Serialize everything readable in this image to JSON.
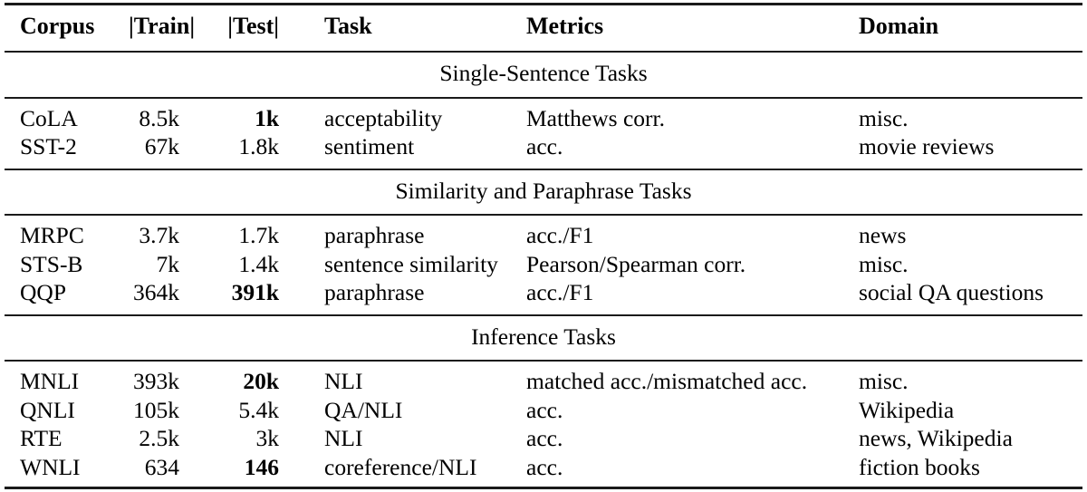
{
  "table": {
    "columns": [
      {
        "key": "corpus",
        "label": "Corpus",
        "align": "left"
      },
      {
        "key": "train",
        "label": "|Train|",
        "align": "right"
      },
      {
        "key": "test",
        "label": "|Test|",
        "align": "right"
      },
      {
        "key": "task",
        "label": "Task",
        "align": "left"
      },
      {
        "key": "metrics",
        "label": "Metrics",
        "align": "left"
      },
      {
        "key": "domain",
        "label": "Domain",
        "align": "left"
      }
    ],
    "sections": [
      {
        "title": "Single-Sentence Tasks",
        "rows": [
          {
            "corpus": "CoLA",
            "train": "8.5k",
            "test": "1k",
            "test_bold": true,
            "task": "acceptability",
            "metrics": "Matthews corr.",
            "domain": "misc."
          },
          {
            "corpus": "SST-2",
            "train": "67k",
            "test": "1.8k",
            "test_bold": false,
            "task": "sentiment",
            "metrics": "acc.",
            "domain": "movie reviews"
          }
        ]
      },
      {
        "title": "Similarity and Paraphrase Tasks",
        "rows": [
          {
            "corpus": "MRPC",
            "train": "3.7k",
            "test": "1.7k",
            "test_bold": false,
            "task": "paraphrase",
            "metrics": "acc./F1",
            "domain": "news"
          },
          {
            "corpus": "STS-B",
            "train": "7k",
            "test": "1.4k",
            "test_bold": false,
            "task": "sentence similarity",
            "metrics": "Pearson/Spearman corr.",
            "domain": "misc."
          },
          {
            "corpus": "QQP",
            "train": "364k",
            "test": "391k",
            "test_bold": true,
            "task": "paraphrase",
            "metrics": "acc./F1",
            "domain": "social QA questions"
          }
        ]
      },
      {
        "title": "Inference Tasks",
        "rows": [
          {
            "corpus": "MNLI",
            "train": "393k",
            "test": "20k",
            "test_bold": true,
            "task": "NLI",
            "metrics": "matched acc./mismatched acc.",
            "domain": "misc."
          },
          {
            "corpus": "QNLI",
            "train": "105k",
            "test": "5.4k",
            "test_bold": false,
            "task": "QA/NLI",
            "metrics": "acc.",
            "domain": "Wikipedia"
          },
          {
            "corpus": "RTE",
            "train": "2.5k",
            "test": "3k",
            "test_bold": false,
            "task": "NLI",
            "metrics": "acc.",
            "domain": "news, Wikipedia"
          },
          {
            "corpus": "WNLI",
            "train": "634",
            "test": "146",
            "test_bold": true,
            "task": "coreference/NLI",
            "metrics": "acc.",
            "domain": "fiction books"
          }
        ]
      }
    ]
  }
}
